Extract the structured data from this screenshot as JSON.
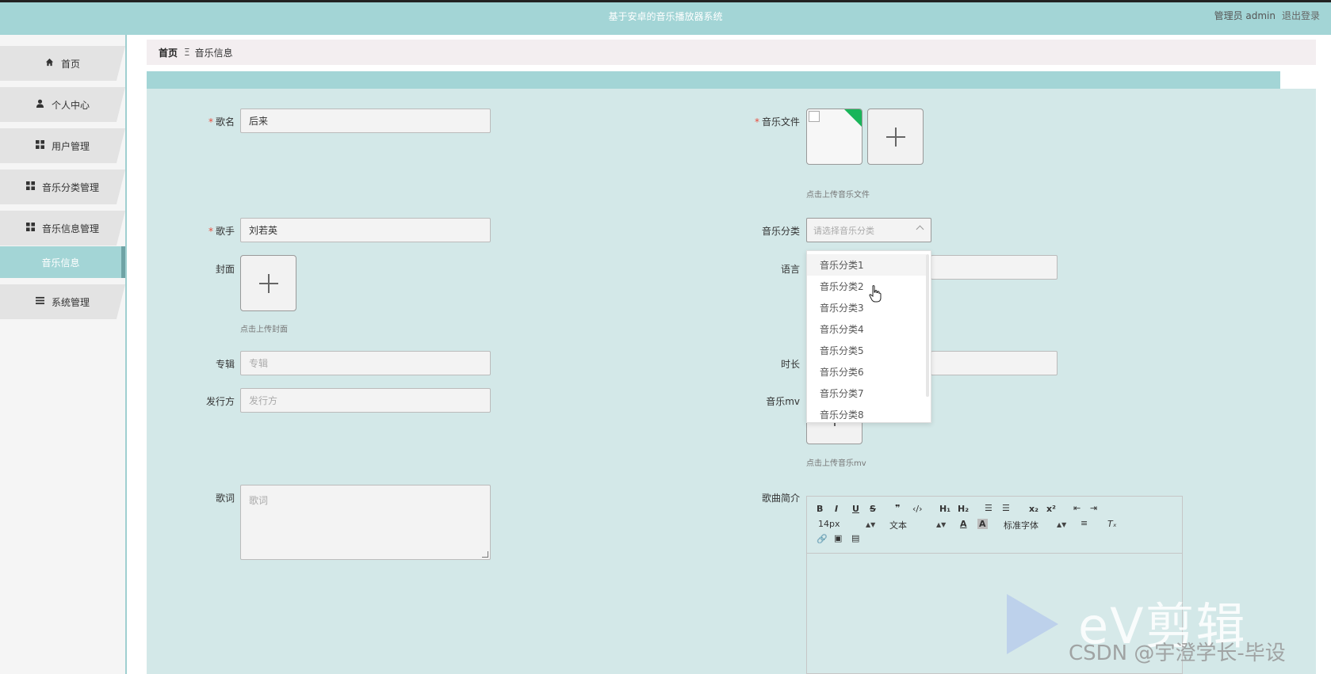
{
  "header": {
    "title": "基于安卓的音乐播放器系统",
    "user": "管理员 admin",
    "logout": "退出登录"
  },
  "sidebar": {
    "items": [
      {
        "label": "首页",
        "icon": "home-icon"
      },
      {
        "label": "个人中心",
        "icon": "user-icon"
      },
      {
        "label": "用户管理",
        "icon": "grid-icon"
      },
      {
        "label": "音乐分类管理",
        "icon": "grid-icon"
      },
      {
        "label": "音乐信息管理",
        "icon": "grid-icon"
      },
      {
        "label": "系统管理",
        "icon": "list-icon"
      }
    ],
    "sub_item": "音乐信息"
  },
  "breadcrumb": {
    "home": "首页",
    "separator": "Ξ",
    "current": "音乐信息"
  },
  "form": {
    "song_name": {
      "label": "歌名",
      "value": "后来"
    },
    "singer": {
      "label": "歌手",
      "value": "刘若英"
    },
    "cover": {
      "label": "封面",
      "hint": "点击上传封面"
    },
    "album": {
      "label": "专辑",
      "placeholder": "专辑"
    },
    "publisher": {
      "label": "发行方",
      "placeholder": "发行方"
    },
    "lyrics": {
      "label": "歌词",
      "placeholder": "歌词"
    },
    "music_file": {
      "label": "音乐文件",
      "hint": "点击上传音乐文件"
    },
    "category": {
      "label": "音乐分类",
      "placeholder": "请选择音乐分类"
    },
    "language": {
      "label": "语言"
    },
    "duration": {
      "label": "时长"
    },
    "mv": {
      "label": "音乐mv",
      "hint": "点击上传音乐mv"
    },
    "intro": {
      "label": "歌曲简介"
    }
  },
  "dropdown": {
    "options": [
      "音乐分类1",
      "音乐分类2",
      "音乐分类3",
      "音乐分类4",
      "音乐分类5",
      "音乐分类6",
      "音乐分类7",
      "音乐分类8"
    ]
  },
  "editor": {
    "font_size": "14px",
    "paragraph": "文本",
    "font_family": "标准字体"
  },
  "watermark": {
    "brand": "eV剪辑",
    "author": "CSDN @宇澄学长-毕设"
  }
}
